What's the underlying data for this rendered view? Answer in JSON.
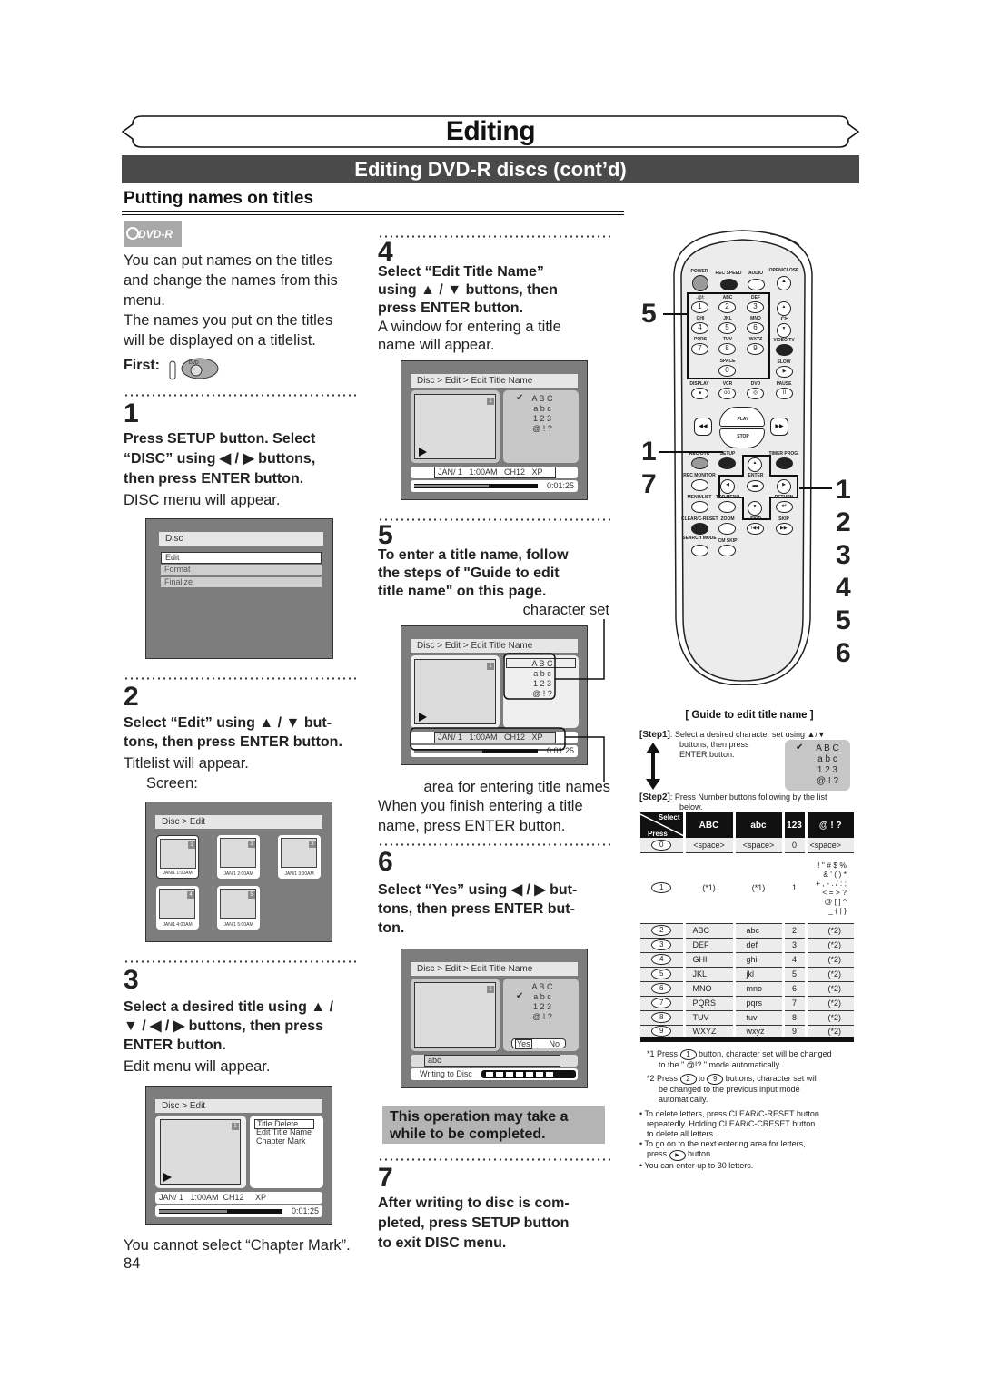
{
  "header": {
    "title": "Editing",
    "subtitle": "Editing DVD-R discs (cont’d)",
    "section": "Putting names on titles",
    "badge": "DVD-R"
  },
  "intro": {
    "lines": [
      "You can put names on the titles",
      "and change the names from this",
      "menu.",
      "The names you put on the titles",
      "will be displayed on a titlelist."
    ],
    "first_label": "First:",
    "first_icon": "dvd-button-icon"
  },
  "steps": [
    {
      "num": "1",
      "bold": [
        "Press SETUP button. Select",
        "“DISC” using ◀ / ▶ buttons,",
        "then press ENTER button."
      ],
      "text": [
        "DISC menu will appear."
      ],
      "screen": {
        "bar": "Disc",
        "items": [
          "Edit",
          "Format",
          "Finalize"
        ],
        "selected": 0
      }
    },
    {
      "num": "2",
      "bold": [
        "Select “Edit” using ▲ / ▼ but-",
        "tons, then press ENTER button."
      ],
      "text": [
        "Titlelist will appear."
      ],
      "caption": "Screen:",
      "screen": {
        "bar": "Disc > Edit",
        "thumbs": [
          {
            "num": "1",
            "date": "JAN/1  1:00AM"
          },
          {
            "num": "2",
            "date": "JAN/1  2:00AM"
          },
          {
            "num": "3",
            "date": "JAN/1  3:00AM"
          },
          {
            "num": "4",
            "date": "JAN/1  4:00AM"
          },
          {
            "num": "5",
            "date": "JAN/1  5:00AM"
          }
        ]
      }
    },
    {
      "num": "3",
      "bold": [
        "Select a desired title using ▲ /",
        "▼ / ◀ / ▶ buttons, then press",
        "ENTER button."
      ],
      "text": [
        "Edit menu will appear."
      ],
      "screen": {
        "bar": "Disc > Edit",
        "tag": "1",
        "menu": [
          "Title Delete",
          "Edit Title Name",
          "Chapter Mark"
        ],
        "info": "JAN/ 1   1:00AM  CH12     XP",
        "time": "0:01:25",
        "progress": 0.55
      },
      "note": "You cannot select “Chapter Mark”."
    },
    {
      "num": "4",
      "bold": [
        "Select “Edit Title Name”",
        "using ▲ / ▼ buttons, then",
        "press ENTER button."
      ],
      "text": [
        "A window for entering a title",
        "name will appear."
      ],
      "screen": {
        "bar": "Disc > Edit > Edit Title Name",
        "tag": "1",
        "charsets": [
          "A B C",
          "a b c",
          "1 2 3",
          "@ ! ?"
        ],
        "check": "✔",
        "info": "JAN/ 1   1:00AM   CH12   XP",
        "time": "0:01:25",
        "progress": 0.6
      }
    },
    {
      "num": "5",
      "bold": [
        "To enter a title name, follow",
        "the steps of \"Guide to edit",
        "title name\" on this page."
      ],
      "callout_top": "character set",
      "callout_bottom": "area for entering title names",
      "text": [
        "When you finish entering a title",
        "name, press ENTER button."
      ],
      "screen": {
        "bar": "Disc > Edit > Edit Title Name",
        "tag": "1",
        "charsets": [
          "A B C",
          "a b c",
          "1 2 3",
          "@ ! ?"
        ],
        "info": "JAN/ 1   1:00AM   CH12   XP",
        "time": "0:01:25",
        "progress": 0.55
      }
    },
    {
      "num": "6",
      "bold": [
        "Select “Yes” using ◀ / ▶ but-",
        "tons, then press ENTER but-",
        "ton."
      ],
      "screen": {
        "bar": "Disc > Edit > Edit Title Name",
        "tag": "1",
        "charsets": [
          "A B C",
          "a b c",
          "1 2 3",
          "@ ! ?"
        ],
        "check": "✔",
        "yes": "Yes",
        "no": "No",
        "name_value": "abc",
        "writing": "Writing to Disc",
        "writing_blocks": 7
      }
    },
    {
      "num": "7",
      "bold": [
        "After writing to disc is com-",
        "pleted, press SETUP button",
        "to exit DISC menu."
      ]
    }
  ],
  "note_box": [
    "This operation may take a",
    "while to be completed."
  ],
  "page_number": "84",
  "remote": {
    "labels": {
      "power": "POWER",
      "rec_speed": "REC SPEED",
      "audio": "AUDIO",
      "open_close": "OPEN/CLOSE",
      "k1": ".@/:",
      "k2": "ABC",
      "k3": "DEF",
      "k4": "GHI",
      "k5": "JKL",
      "k6": "MNO",
      "k7": "PQRS",
      "k8": "TUV",
      "k9": "WXYZ",
      "k0": "SPACE",
      "ch": "CH",
      "video_tv": "VIDEO/TV",
      "slow": "SLOW",
      "display": "DISPLAY",
      "vcr": "VCR",
      "dvd": "DVD",
      "pause": "PAUSE",
      "play": "PLAY",
      "stop": "STOP",
      "rec_otr": "REC/OTR",
      "setup": "SETUP",
      "timer_prog": "TIMER PROG.",
      "rec_monitor": "REC MONITOR",
      "enter": "ENTER",
      "menu_list": "MENU/LIST",
      "top_menu": "TOP MENU",
      "return": "RETURN",
      "clear": "CLEAR/C-RESET",
      "zoom": "ZOOM",
      "skip_back": "SKIP",
      "skip_fwd": "SKIP",
      "search_mode": "SEARCH MODE",
      "cm_skip": "CM SKIP"
    },
    "digits": [
      "1",
      "2",
      "3",
      "4",
      "5",
      "6",
      "7",
      "8",
      "9",
      "0"
    ],
    "callouts_left": [
      "5",
      "1",
      "7"
    ],
    "callouts_right": [
      "1",
      "2",
      "3",
      "4",
      "5",
      "6"
    ]
  },
  "guide": {
    "title": "[ Guide to edit title name ]",
    "step1_label": "[Step1]",
    "step1_text": [
      ": Select a desired character set using ▲/▼",
      "buttons, then press",
      "ENTER button."
    ],
    "step1_sets": [
      "A B C",
      "a b c",
      "1 2 3",
      "@ ! ?"
    ],
    "check": "✔",
    "step2_label": "[Step2]",
    "step2_text": [
      ": Press Number buttons following by the list",
      "below."
    ],
    "table": {
      "corner_top": "Select",
      "corner_bottom": "Press",
      "headers": [
        "ABC",
        "abc",
        "123",
        "@ ! ?"
      ],
      "rows": [
        {
          "key": "0",
          "c": [
            "<space>",
            "<space>",
            "0",
            "<space>"
          ]
        },
        {
          "key": "1",
          "c": [
            "(*1)",
            "(*1)",
            "1",
            "! \" # $ %\n& ' ( ) *\n+ , - . / : ;\n< = > ?\n@ [ ] ^\n_ { | }"
          ]
        },
        {
          "key": "2",
          "c": [
            "ABC",
            "abc",
            "2",
            "(*2)"
          ]
        },
        {
          "key": "3",
          "c": [
            "DEF",
            "def",
            "3",
            "(*2)"
          ]
        },
        {
          "key": "4",
          "c": [
            "GHI",
            "ghi",
            "4",
            "(*2)"
          ]
        },
        {
          "key": "5",
          "c": [
            "JKL",
            "jkl",
            "5",
            "(*2)"
          ]
        },
        {
          "key": "6",
          "c": [
            "MNO",
            "mno",
            "6",
            "(*2)"
          ]
        },
        {
          "key": "7",
          "c": [
            "PQRS",
            "pqrs",
            "7",
            "(*2)"
          ]
        },
        {
          "key": "8",
          "c": [
            "TUV",
            "tuv",
            "8",
            "(*2)"
          ]
        },
        {
          "key": "9",
          "c": [
            "WXYZ",
            "wxyz",
            "9",
            "(*2)"
          ]
        }
      ]
    },
    "notes": {
      "n1_pre": "*1 Press",
      "n1_key": "1",
      "n1_post": "button, character set will be changed",
      "n1_line2": "to the \" @!? \" mode automatically.",
      "n2_pre": "*2 Press",
      "n2_key_a": "2",
      "n2_to": "to",
      "n2_key_b": "9",
      "n2_post": "buttons, character set will",
      "n2_line2": "be changed to the previous input mode",
      "n2_line3": "automatically.",
      "b1": [
        "To delete letters, press CLEAR/C-RESET button",
        "repeatedly. Holding CLEAR/C-CRESET button",
        "to delete all letters."
      ],
      "b2_line1": "To go on to the next entering area for letters,",
      "b2_pre": "press",
      "b2_post": "button.",
      "b3": "You can enter up to 30 letters."
    }
  }
}
